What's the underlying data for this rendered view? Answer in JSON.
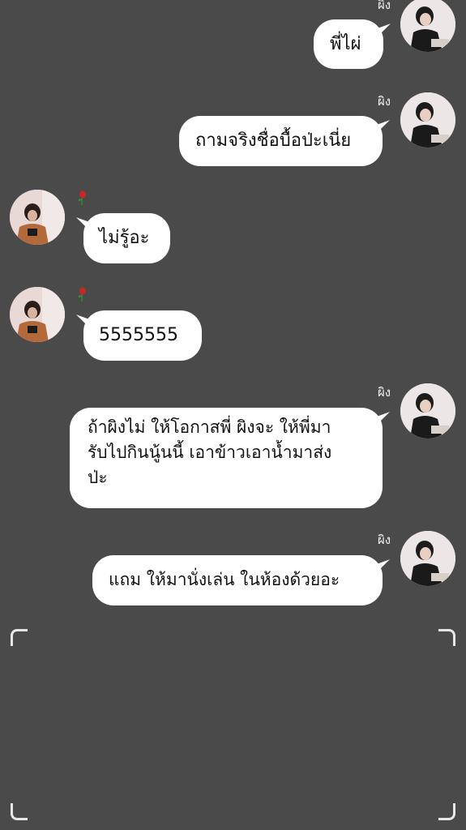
{
  "chat": {
    "messages": [
      {
        "sender": "ผิง",
        "direction": "outgoing",
        "text": "พี่ไผ่"
      },
      {
        "sender": "ผิง",
        "direction": "outgoing",
        "text": "ถามจริงชื่อบื้อป่ะเนี่ย"
      },
      {
        "sender": "",
        "direction": "incoming",
        "text": "ไม่รู้อะ"
      },
      {
        "sender": "",
        "direction": "incoming",
        "text": "5555555"
      },
      {
        "sender": "ผิง",
        "direction": "outgoing",
        "text": "ถ้าผิงไม่ ให้โอกาสพี่ ผิงจะ ให้พี่มา\nรับไปกินนู้นนี้ เอาข้าวเอาน้ำมาส่ง\nป่ะ"
      },
      {
        "sender": "ผิง",
        "direction": "outgoing",
        "text": "แถม ให้มานั่งเล่น ในห้องด้วยอะ"
      }
    ]
  },
  "colors": {
    "background": "#4a4a4a",
    "bubble": "#ffffff",
    "text": "#111111",
    "name": "#f2f2f2"
  }
}
